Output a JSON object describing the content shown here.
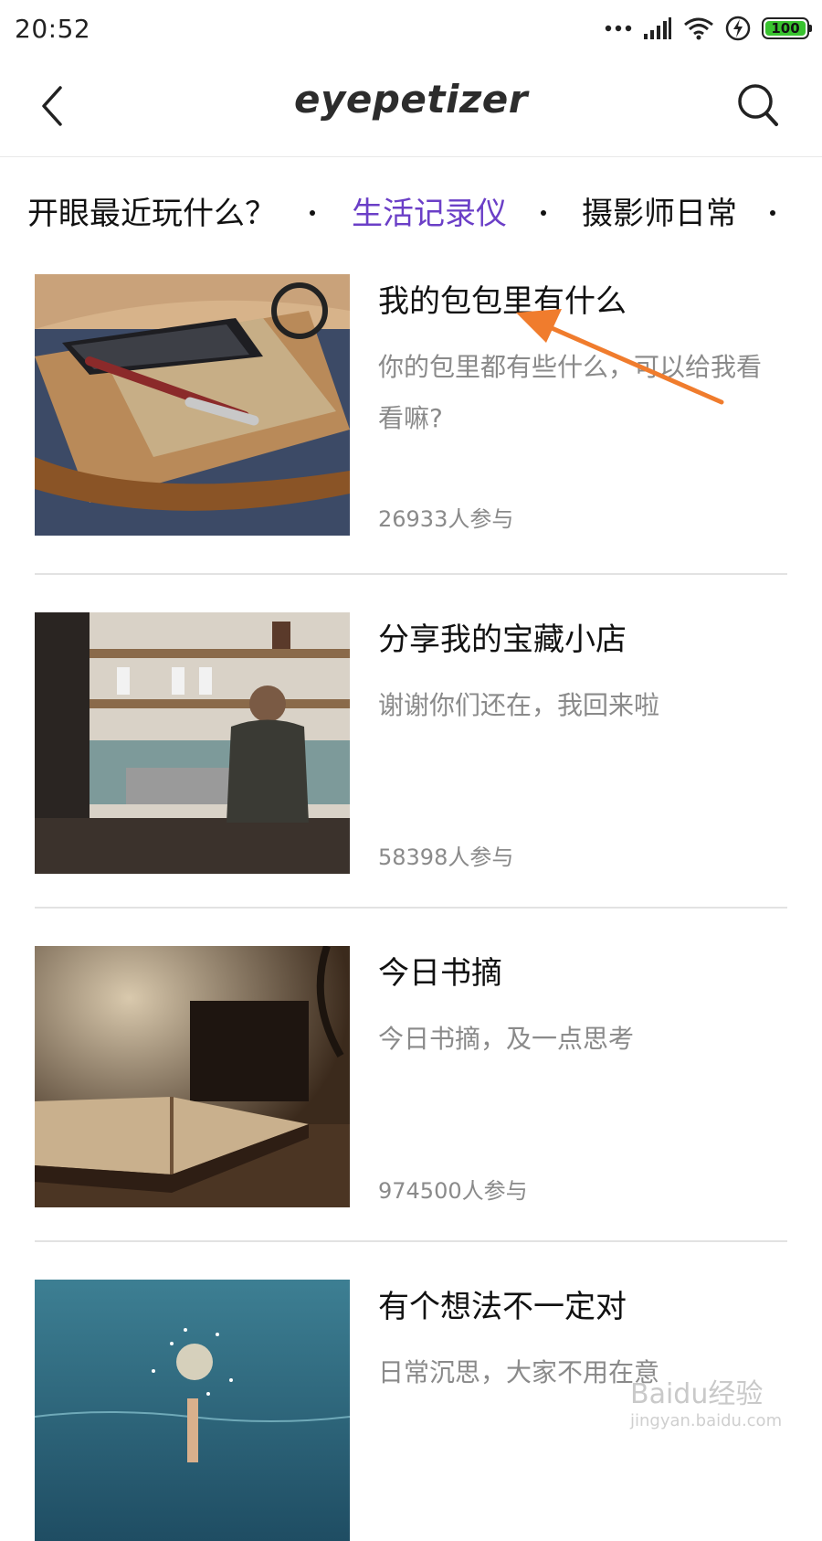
{
  "status_bar": {
    "time": "20:52",
    "battery": "100",
    "icons": [
      "more-dots-icon",
      "signal-icon",
      "wifi-icon",
      "charging-icon",
      "battery-icon"
    ]
  },
  "header": {
    "logo": "eyepetizer",
    "back_icon": "chevron-left-icon",
    "search_icon": "search-icon"
  },
  "tabs": [
    {
      "label": "开眼最近玩什么？",
      "active": false
    },
    {
      "label": "生活记录仪",
      "active": true
    },
    {
      "label": "摄影师日常",
      "active": false
    }
  ],
  "colors": {
    "accent": "#6b3fc7",
    "annotation_arrow": "#f07c2d",
    "battery_green": "#39c32f"
  },
  "cards": [
    {
      "title": "我的包包里有什么",
      "desc": "你的包里都有些什么，可以给我看看嘛?",
      "count": "26933人参与",
      "image": "bag-contents-photo"
    },
    {
      "title": "分享我的宝藏小店",
      "desc": "谢谢你们还在，我回来啦",
      "count": "58398人参与",
      "image": "coffee-shop-barista-photo"
    },
    {
      "title": "今日书摘",
      "desc": "今日书摘，及一点思考",
      "count": "974500人参与",
      "image": "open-book-photo"
    },
    {
      "title": "有个想法不一定对",
      "desc": "日常沉思，大家不用在意",
      "count": "",
      "image": "sparkler-in-sea-photo"
    }
  ],
  "watermark": {
    "logo": "Baidu经验",
    "url": "jingyan.baidu.com"
  }
}
